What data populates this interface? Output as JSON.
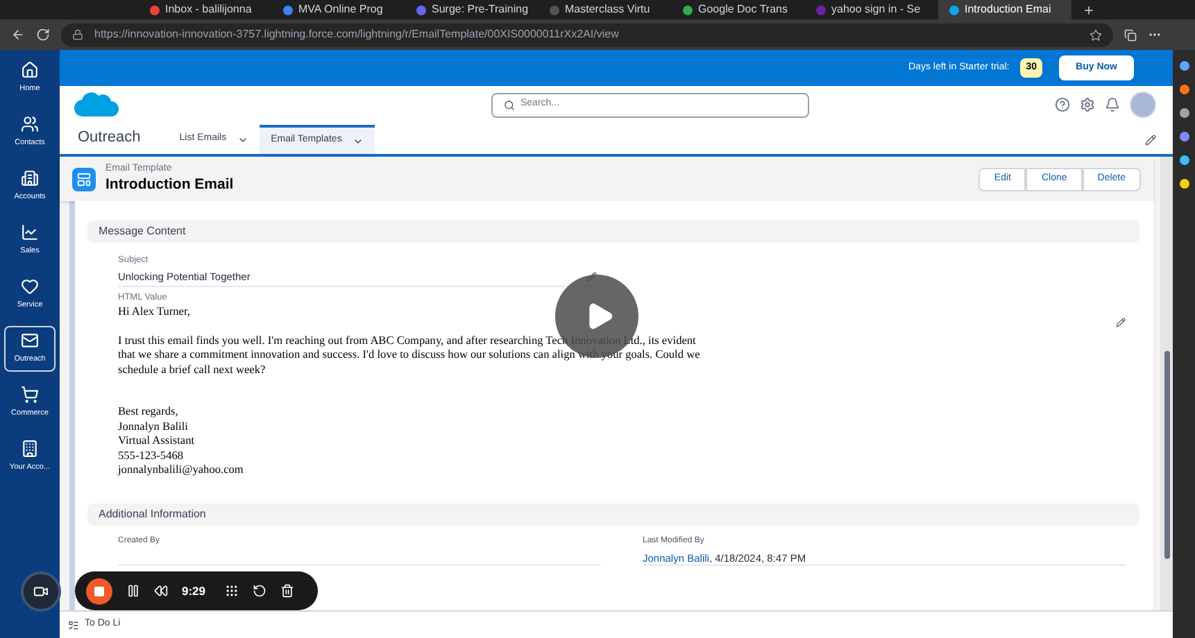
{
  "browser": {
    "tabs": [
      {
        "title": "Inbox - balilijonna",
        "selected": false
      },
      {
        "title": "MVA Online Prog",
        "selected": false
      },
      {
        "title": "Surge: Pre-Training",
        "selected": false
      },
      {
        "title": "Masterclass Virtu",
        "selected": false
      },
      {
        "title": "Google Doc Trans",
        "selected": false
      },
      {
        "title": "yahoo sign in - Se",
        "selected": false
      },
      {
        "title": "Introduction Emai",
        "selected": true
      }
    ],
    "address": "https://innovation-innovation-3757.lightning.force.com/lightning/r/EmailTemplate/00XIS0000011rXx2AI/view"
  },
  "nav": [
    {
      "label": "Home",
      "selected": false
    },
    {
      "label": "Contacts",
      "selected": false
    },
    {
      "label": "Accounts",
      "selected": false
    },
    {
      "label": "Sales",
      "selected": false
    },
    {
      "label": "Service",
      "selected": false
    },
    {
      "label": "Outreach",
      "selected": true
    },
    {
      "label": "Commerce",
      "selected": false
    },
    {
      "label": "Your Acco...",
      "selected": false
    }
  ],
  "trial": {
    "label": "Days left in Starter trial:",
    "days": "30",
    "button": "Buy Now"
  },
  "search": {
    "placeholder": "Search..."
  },
  "app": {
    "name": "Outreach",
    "tabs": [
      {
        "label": "List Emails",
        "selected": false
      },
      {
        "label": "Email Templates",
        "selected": true
      }
    ]
  },
  "record": {
    "type": "Email Template",
    "title": "Introduction Email",
    "actions": [
      "Edit",
      "Clone",
      "Delete"
    ]
  },
  "message": {
    "title": "Message Content",
    "subject_label": "Subject",
    "subject": "Unlocking Potential Together",
    "html_label": "HTML Value",
    "greeting": "Hi Alex Turner,",
    "paragraph": "I trust this email finds you well. I'm reaching out from ABC Company, and after researching Tech Innovation Ltd., its evident that we share a commitment innovation and success. I'd love to discuss how our solutions can align with your goals. Could we schedule a brief call next week?",
    "signature": [
      "Best regards,",
      "Jonnalyn Balili",
      "Virtual Assistant",
      "555-123-5468",
      "jonnalynbalili@yahoo.com"
    ]
  },
  "additional": {
    "title": "Additional Information",
    "created_label": "Created By",
    "modified_label": "Last Modified By",
    "modified_by": "Jonnalyn Balili",
    "modified_date": ", 4/18/2024, 8:47 PM"
  },
  "recorder": {
    "time": "9:29"
  },
  "utility": {
    "label": "To Do Li"
  }
}
